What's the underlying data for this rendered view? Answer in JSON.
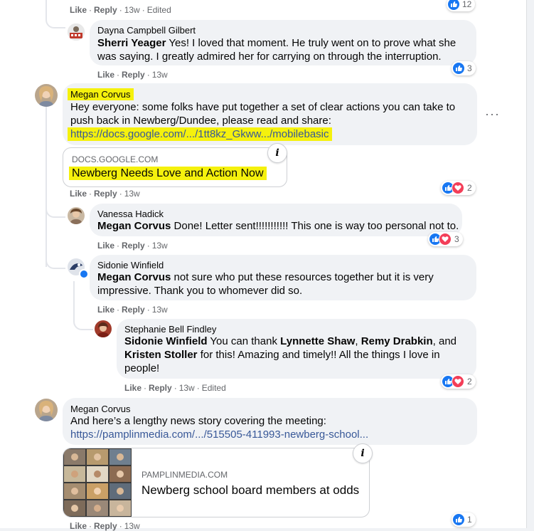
{
  "comments": {
    "top_reply_actions": {
      "like": "Like",
      "reply": "Reply",
      "time": "13w",
      "edited": "Edited",
      "reaction_count": "12"
    },
    "dayna": {
      "author": "Dayna Campbell Gilbert",
      "mention": "Sherri Yeager",
      "text": " Yes! I loved that moment. He truly went on to prove what she was saying. I greatly admired her for carrying on through the interruption.",
      "actions": {
        "like": "Like",
        "reply": "Reply",
        "time": "13w"
      },
      "reaction_count": "3"
    },
    "megan1": {
      "author": "Megan Corvus",
      "text": "Hey everyone: some folks have put together a set of clear actions you can take to push back in Newberg/Dundee, please read and share:",
      "link": "https://docs.google.com/.../1tt8kz_Gkww.../mobilebasic",
      "card_domain": "DOCS.GOOGLE.COM",
      "card_title": "Newberg Needs Love and Action Now",
      "actions": {
        "like": "Like",
        "reply": "Reply",
        "time": "13w"
      },
      "reaction_count": "2",
      "more": "···"
    },
    "vanessa": {
      "author": "Vanessa Hadick",
      "mention": "Megan Corvus",
      "text": " Done! Letter sent!!!!!!!!!!! This one is way too personal not to.",
      "actions": {
        "like": "Like",
        "reply": "Reply",
        "time": "13w"
      },
      "reaction_count": "3"
    },
    "sidonie": {
      "author": "Sidonie Winfield",
      "mention": "Megan Corvus",
      "text": " not sure who put these resources together but it is very impressive. Thank you to whomever did so.",
      "actions": {
        "like": "Like",
        "reply": "Reply",
        "time": "13w"
      }
    },
    "stephanie": {
      "author": "Stephanie Bell Findley",
      "mention1": "Sidonie Winfield",
      "t1": " You can thank ",
      "mention2": "Lynnette Shaw",
      "t2": ", ",
      "mention3": "Remy Drabkin",
      "t3": ", and ",
      "mention4": "Kristen Stoller",
      "t4": " for this! Amazing and timely!! All the things I love in people!",
      "actions": {
        "like": "Like",
        "reply": "Reply",
        "time": "13w",
        "edited": "Edited"
      },
      "reaction_count": "2"
    },
    "megan2": {
      "author": "Megan Corvus",
      "text": "And here’s a lengthy news story covering the meeting:",
      "link": "https://pamplinmedia.com/.../515505-411993-newberg-school...",
      "card_domain": "PAMPLINMEDIA.COM",
      "card_title": "Newberg school board members at odds",
      "actions": {
        "like": "Like",
        "reply": "Reply",
        "time": "13w"
      },
      "reaction_count": "1"
    }
  },
  "info_icon": "i",
  "colors": {
    "accent": "#1877f2",
    "love": "#f33e58",
    "highlight": "#f5f10d",
    "link": "#385898"
  }
}
